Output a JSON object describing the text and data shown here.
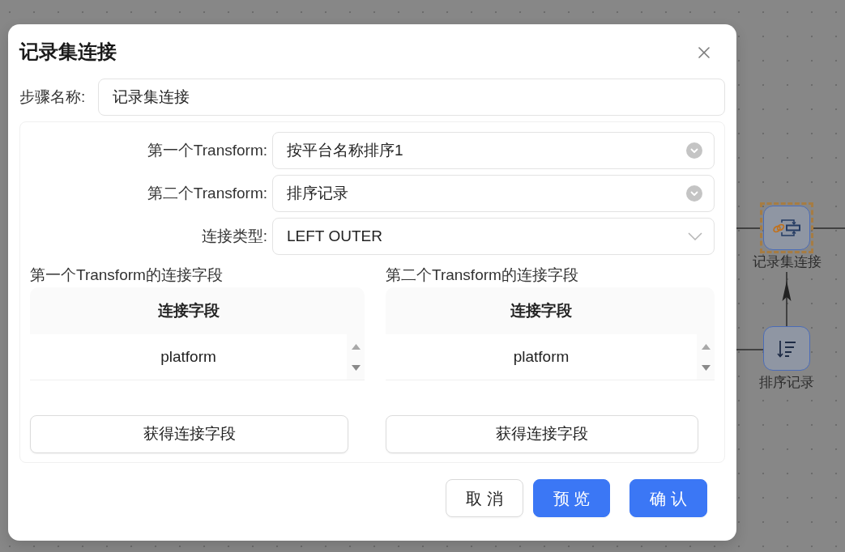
{
  "dialog": {
    "title": "记录集连接",
    "step_name": {
      "label": "步骤名称:",
      "value": "记录集连接"
    },
    "fields": [
      {
        "kind": "combo",
        "label": "第一个Transform:",
        "value": "按平台名称排序1"
      },
      {
        "kind": "combo",
        "label": "第二个Transform:",
        "value": "排序记录"
      },
      {
        "kind": "select",
        "label": "连接类型:",
        "value": "LEFT OUTER"
      }
    ],
    "key_tables": [
      {
        "title": "第一个Transform的连接字段",
        "column": "连接字段",
        "rows": [
          "platform"
        ],
        "button": "获得连接字段"
      },
      {
        "title": "第二个Transform的连接字段",
        "column": "连接字段",
        "rows": [
          "platform"
        ],
        "button": "获得连接字段"
      }
    ],
    "buttons": [
      {
        "kind": "default",
        "label": "取 消"
      },
      {
        "kind": "primary",
        "label": "预 览"
      },
      {
        "kind": "primary",
        "label": "确 认"
      }
    ]
  },
  "canvas": {
    "nodes": [
      {
        "kind": "join",
        "label": "记录集连接",
        "selected": true
      },
      {
        "kind": "sort",
        "label": "排序记录",
        "selected": false
      }
    ]
  }
}
